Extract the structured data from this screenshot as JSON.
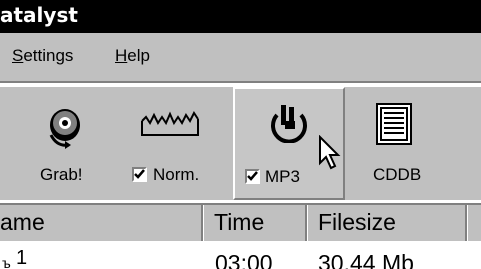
{
  "window": {
    "title": "atalyst"
  },
  "menu": {
    "settings_prefix": "",
    "settings_u": "S",
    "settings_rest": "ettings",
    "help_u": "H",
    "help_rest": "elp"
  },
  "toolbar": {
    "grab_label": "Grab!",
    "norm_label": "Norm.",
    "mp3_label": "MP3",
    "cddb_label": "CDDB",
    "norm_checked": true,
    "mp3_checked": true
  },
  "list": {
    "columns": [
      "ame",
      "Time",
      "Filesize"
    ],
    "rows": [
      {
        "name": "1",
        "time": "03:00",
        "filesize": "30.44 Mb"
      }
    ]
  }
}
